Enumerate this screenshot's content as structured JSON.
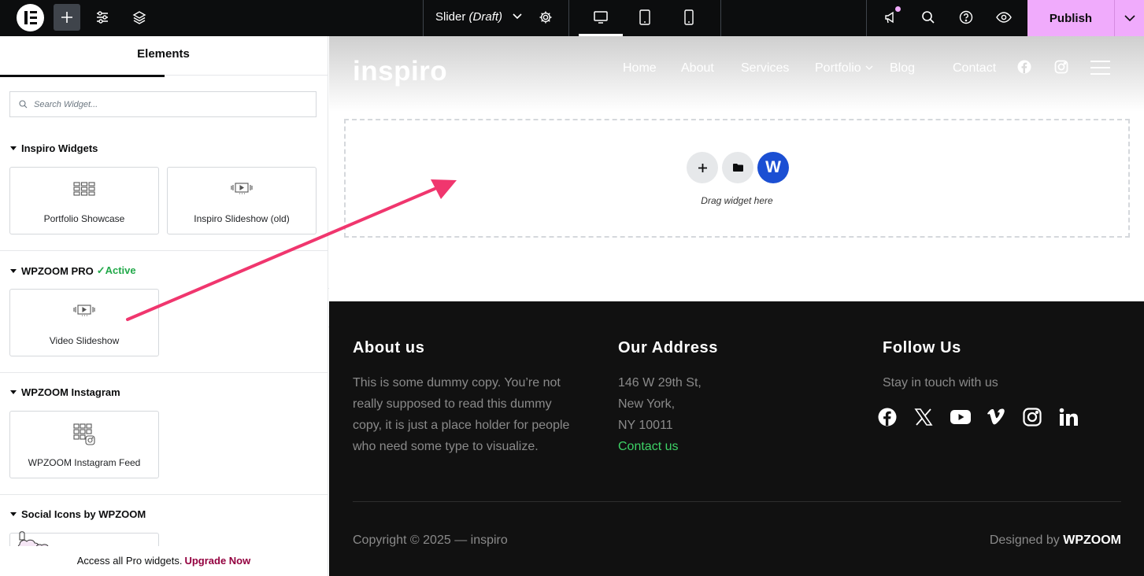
{
  "topbar": {
    "document_title": "Slider",
    "document_status": "(Draft)",
    "publish_label": "Publish",
    "icons": [
      "elementor-logo-icon",
      "add-element-icon",
      "site-settings-icon",
      "structure-icon",
      "chevron-down-icon",
      "page-settings-icon",
      "desktop-icon",
      "tablet-icon",
      "mobile-icon",
      "notifications-icon",
      "search-icon",
      "help-icon",
      "preview-icon",
      "publish-options-icon"
    ]
  },
  "panel": {
    "tab_label": "Elements",
    "search_placeholder": "Search Widget...",
    "categories": [
      {
        "title": "Inspiro Widgets",
        "badge": "",
        "widgets": [
          "Portfolio Showcase",
          "Inspiro Slideshow (old)"
        ]
      },
      {
        "title": "WPZOOM PRO",
        "badge": "✓Active",
        "widgets": [
          "Video Slideshow"
        ]
      },
      {
        "title": "WPZOOM Instagram",
        "badge": "",
        "widgets": [
          "WPZOOM Instagram Feed"
        ]
      },
      {
        "title": "Social Icons by WPZOOM",
        "badge": "",
        "widgets": []
      }
    ],
    "upgrade_text": "Access all Pro widgets.",
    "upgrade_link": "Upgrade Now"
  },
  "site": {
    "logo": "inspiro",
    "nav": [
      "Home",
      "About",
      "Services",
      "Portfolio",
      "Blog",
      "Contact"
    ],
    "dropzone_text": "Drag widget here",
    "dropzone_w_label": "W"
  },
  "footer": {
    "about": {
      "heading": "About us",
      "lines": [
        "This is some dummy copy. You’re not",
        "really supposed to read this dummy",
        "copy, it is just a place holder for people",
        "who need some type to visualize."
      ]
    },
    "address": {
      "heading": "Our Address",
      "lines": [
        "146 W 29th St,",
        "New York,",
        "NY 10011"
      ],
      "link": "Contact us"
    },
    "follow": {
      "heading": "Follow Us",
      "text": "Stay in touch with us",
      "icons": [
        "facebook-icon",
        "x-icon",
        "youtube-icon",
        "vimeo-icon",
        "instagram-icon",
        "linkedin-icon"
      ]
    },
    "copyright": "Copyright © 2025 — inspiro",
    "designed_by": "Designed by",
    "designer": "WPZOOM"
  },
  "colors": {
    "topbar_bg": "#0c0d0e",
    "publish_bg": "#f0abfc",
    "active_green": "#22a94a",
    "upgrade_link": "#93003f",
    "footer_bg": "#111111",
    "footer_link": "#3dd266",
    "wpzoom_blue": "#1b4fd3",
    "arrow": "#f0366e"
  }
}
